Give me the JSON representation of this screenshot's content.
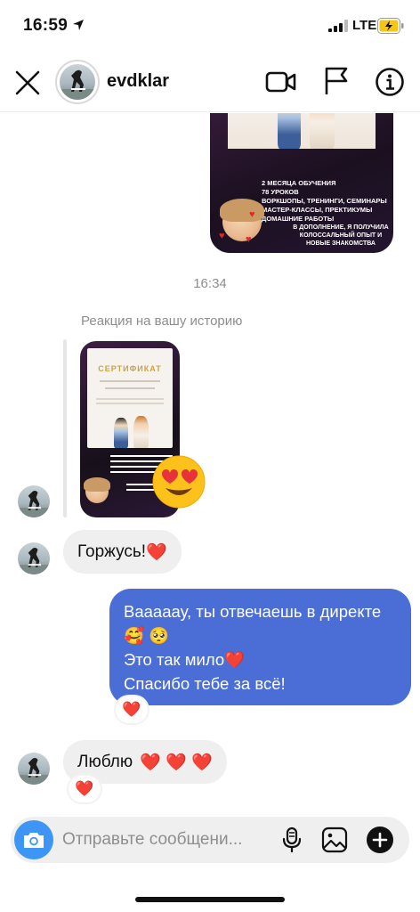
{
  "status_bar": {
    "time": "16:59",
    "network": "LTE",
    "battery_color": "#f5c518"
  },
  "header": {
    "username": "evdklar"
  },
  "chat": {
    "top_story_card": {
      "lines": [
        "2 МЕСЯЦА ОБУЧЕНИЯ",
        "78 УРОКОВ",
        "ВОРКШОПЫ, ТРЕНИНГИ, СЕМИНАРЫ",
        "МАСТЕР-КЛАССЫ, ПРЕКТИКУМЫ",
        "ДОМАШНИЕ РАБОТЫ"
      ],
      "extra": "В ДОПОЛНЕНИЕ, Я ПОЛУЧИЛА КОЛОССАЛЬНЫЙ ОПЫТ И НОВЫЕ ЗНАКОМСТВА"
    },
    "timestamp": "16:34",
    "story_reaction_label": "Реакция на вашу историю",
    "story_thumb_title": "СЕРТИФИКАТ",
    "messages": [
      {
        "direction": "in",
        "text": "Горжусь!",
        "emoji": "❤️"
      },
      {
        "direction": "out",
        "lines": [
          "Вааааау, ты отвечаешь в директе",
          "🥰 🥺",
          "Это так мило❤️",
          "Спасибо тебе за всё!"
        ],
        "reaction": "❤️"
      },
      {
        "direction": "in",
        "text": "Люблю",
        "emoji": "❤️ ❤️ ❤️",
        "reaction": "❤️"
      }
    ]
  },
  "composer": {
    "placeholder": "Отправьте сообщени..."
  },
  "colors": {
    "outgoing_bubble": "#4a6ed6",
    "incoming_bubble": "#efefef",
    "camera_button": "#3d96f5",
    "heart": "#e3262b"
  }
}
